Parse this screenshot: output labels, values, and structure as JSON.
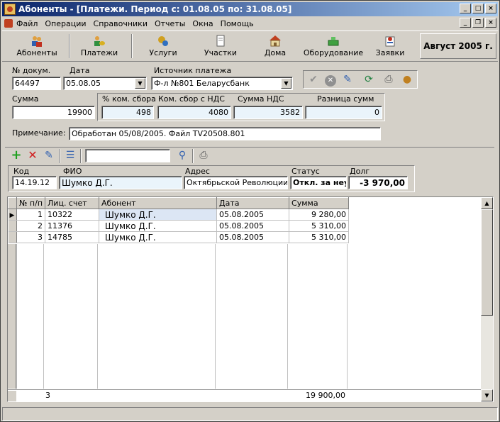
{
  "window": {
    "title": "Абоненты - [Платежи. Период с: 01.08.05 по: 31.08.05]"
  },
  "menu": [
    "Файл",
    "Операции",
    "Справочники",
    "Отчеты",
    "Окна",
    "Помощь"
  ],
  "toolbar": {
    "buttons": [
      {
        "label": "Абоненты",
        "icon": "subscribers-icon"
      },
      {
        "label": "Платежи",
        "icon": "payments-icon"
      },
      {
        "label": "Услуги",
        "icon": "services-icon"
      },
      {
        "label": "Участки",
        "icon": "sections-icon"
      },
      {
        "label": "Дома",
        "icon": "house-icon"
      },
      {
        "label": "Оборудование",
        "icon": "equipment-icon"
      },
      {
        "label": "Заявки",
        "icon": "requests-icon"
      }
    ],
    "period": "Август 2005 г."
  },
  "doc": {
    "doc_no_label": "№ докум.",
    "doc_no": "64497",
    "date_label": "Дата",
    "date": "05.08.05",
    "source_label": "Источник платежа",
    "source": "Ф-л №801 Беларусбанк",
    "sum_label": "Сумма",
    "sum": "19900",
    "fee_pct_label": "% ком. сбора",
    "fee_pct": "498",
    "fee_vat_label": "Ком. сбор с НДС",
    "fee_vat": "4080",
    "vat_sum_label": "Сумма НДС",
    "vat_sum": "3582",
    "diff_label": "Разница сумм",
    "diff": "0",
    "note_label": "Примечание:",
    "note": "Обработан 05/08/2005. Файл TV20508.801"
  },
  "subscriber": {
    "code_label": "Код",
    "code": "14.19.12",
    "fio_label": "ФИО",
    "fio": "Шумко Д.Г.",
    "address_label": "Адрес",
    "address": "Октябрьской Революции  д.",
    "status_label": "Статус",
    "status": "Откл. за неу",
    "debt_label": "Долг",
    "debt": "-3 970,00"
  },
  "grid": {
    "columns": [
      "№ п/п",
      "Лиц. счет",
      "Абонент",
      "Дата",
      "Сумма"
    ],
    "rows": [
      {
        "n": "1",
        "account": "10322",
        "subscriber": "Шумко Д.Г.",
        "date": "05.08.2005",
        "sum": "9 280,00"
      },
      {
        "n": "2",
        "account": "11376",
        "subscriber": "Шумко Д.Г.",
        "date": "05.08.2005",
        "sum": "5 310,00"
      },
      {
        "n": "3",
        "account": "14785",
        "subscriber": "Шумко Д.Г.",
        "date": "05.08.2005",
        "sum": "5 310,00"
      }
    ],
    "footer": {
      "count": "3",
      "total": "19 900,00"
    }
  }
}
